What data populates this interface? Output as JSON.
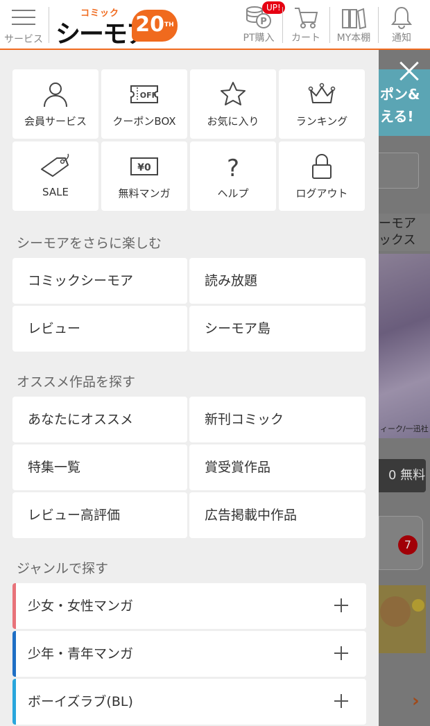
{
  "header": {
    "menu_label": "サービス",
    "logo_small": "コミック",
    "logo_big": "シーモア",
    "logo_anniv": "20",
    "logo_th": "TH",
    "pt_label": "PT購入",
    "up_badge": "UP!",
    "cart_label": "カート",
    "shelf_label": "MY本棚",
    "notify_label": "通知",
    "accent_color": "#f06a1e"
  },
  "quick_menu": [
    {
      "label": "会員サービス",
      "icon": "person-icon"
    },
    {
      "label": "クーポンBOX",
      "icon": "coupon-icon",
      "icon_text": "OFF"
    },
    {
      "label": "お気に入り",
      "icon": "star-icon"
    },
    {
      "label": "ランキング",
      "icon": "crown-icon"
    },
    {
      "label": "SALE",
      "icon": "tag-icon"
    },
    {
      "label": "無料マンガ",
      "icon": "free-icon",
      "icon_text": "¥0"
    },
    {
      "label": "ヘルプ",
      "icon": "question-icon",
      "icon_text": "?"
    },
    {
      "label": "ログアウト",
      "icon": "lock-icon"
    }
  ],
  "enjoy": {
    "title": "シーモアをさらに楽しむ",
    "items": [
      "コミックシーモア",
      "読み放題",
      "レビュー",
      "シーモア島"
    ]
  },
  "recommend": {
    "title": "オススメ作品を探す",
    "items": [
      "あなたにオススメ",
      "新刊コミック",
      "特集一覧",
      "賞受賞作品",
      "レビュー高評価",
      "広告掲載中作品"
    ]
  },
  "genre": {
    "title": "ジャンルで探す",
    "items": [
      {
        "label": "少女・女性マンガ",
        "color": "#e8737a"
      },
      {
        "label": "少年・青年マンガ",
        "color": "#1f6fc5"
      },
      {
        "label": "ボーイズラブ(BL)",
        "color": "#29a6dc"
      }
    ]
  },
  "background": {
    "banner": "ポン&\nえる!",
    "side_text": "ーモア\nックス",
    "art_caption": "ィーク/一迅社",
    "free_label": "0 無料",
    "badge": "7",
    "arrow": "›"
  }
}
